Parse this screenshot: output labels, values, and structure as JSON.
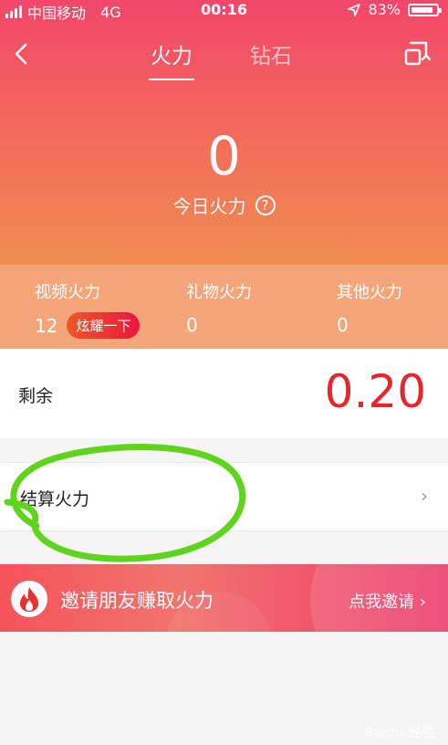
{
  "status": {
    "carrier": "中国移动",
    "network": "4G",
    "time": "00:16",
    "battery": "83%"
  },
  "nav": {
    "tab_active": "火力",
    "tab_inactive": "钻石"
  },
  "summary": {
    "value": "0",
    "label": "今日火力",
    "help": "?"
  },
  "stats": [
    {
      "label": "视频火力",
      "value": "12",
      "badge": "炫耀一下"
    },
    {
      "label": "礼物火力",
      "value": "0"
    },
    {
      "label": "其他火力",
      "value": "0"
    }
  ],
  "remaining": {
    "label": "剩余",
    "value": "0.20"
  },
  "settle": {
    "label": "结算火力",
    "chevron": "›"
  },
  "invite": {
    "title": "邀请朋友赚取火力",
    "cta": "点我邀请 ›"
  },
  "watermark": "Baidu 经验",
  "colors": {
    "accent_red": "#e8252a",
    "header_top": "#f2466a",
    "header_bottom": "#f08c52",
    "stats_band": "#f4a57a",
    "annotation_green": "#5fd41e"
  },
  "icons": {
    "back": "chevron-left-icon",
    "nav_right": "exchange-icon",
    "help": "help-circle-icon",
    "flame": "flame-icon"
  }
}
